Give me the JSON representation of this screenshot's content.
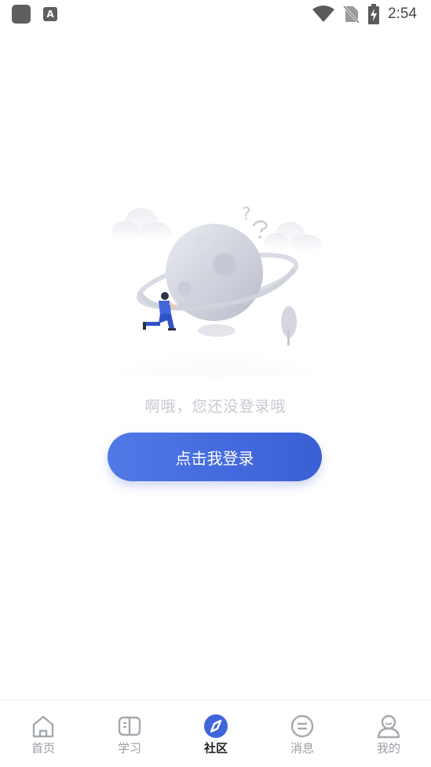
{
  "status_bar": {
    "time": "2:54",
    "app_icon_letter": "A",
    "icons": [
      "app-notification-icon",
      "text-app-icon",
      "wifi-icon",
      "no-sim-icon",
      "battery-charging-icon"
    ]
  },
  "main": {
    "empty_message": "啊哦，您还没登录哦",
    "login_button_label": "点击我登录",
    "illustration_icon": "empty-planet-illustration"
  },
  "bottom_nav": {
    "active_index": 2,
    "items": [
      {
        "label": "首页",
        "icon": "home-icon"
      },
      {
        "label": "学习",
        "icon": "book-icon"
      },
      {
        "label": "社区",
        "icon": "compass-icon"
      },
      {
        "label": "消息",
        "icon": "message-icon"
      },
      {
        "label": "我的",
        "icon": "profile-icon"
      }
    ]
  },
  "colors": {
    "accent": "#3f66dd",
    "empty_text": "#c6c9d2",
    "nav_inactive": "#9a9da3",
    "nav_active": "#222222"
  }
}
